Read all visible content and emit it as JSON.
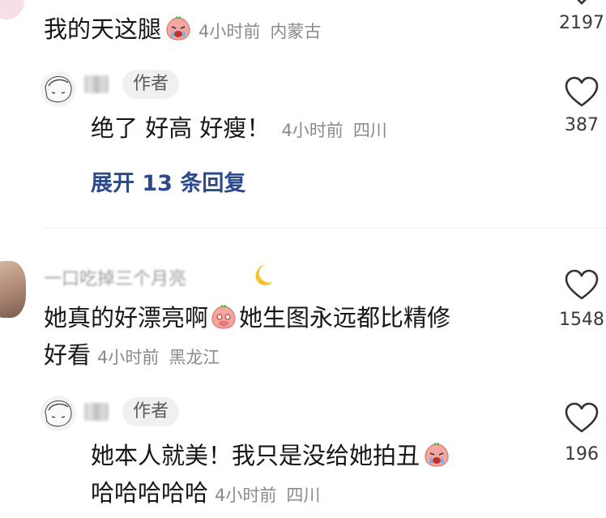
{
  "comment1": {
    "text": "我的天这腿",
    "emoji": "crying-peach-emoji",
    "time": "4小时前",
    "location": "内蒙古",
    "likes": "2197"
  },
  "reply1": {
    "badge": "作者",
    "text": "绝了 好高 好瘦！",
    "time": "4小时前",
    "location": "四川",
    "likes": "387"
  },
  "expand_label": "展开 13 条回复",
  "comment2": {
    "username": "一口吃掉三个月亮",
    "text_line1": "她真的好漂亮啊",
    "emoji": "shy-peach-emoji",
    "text_line1b": "她生图永远都比精修",
    "text_line2": "好看",
    "time": "4小时前",
    "location": "黑龙江",
    "likes": "1548"
  },
  "reply2": {
    "badge": "作者",
    "text_line1": "她本人就美！我只是没给她拍丑",
    "emoji": "crying-peach-emoji",
    "text_line2": "哈哈哈哈哈",
    "time": "4小时前",
    "location": "四川",
    "likes": "196"
  },
  "colors": {
    "link": "#2a4a8c",
    "meta": "#8a8a8a",
    "badge_bg": "#f0f0f0"
  }
}
